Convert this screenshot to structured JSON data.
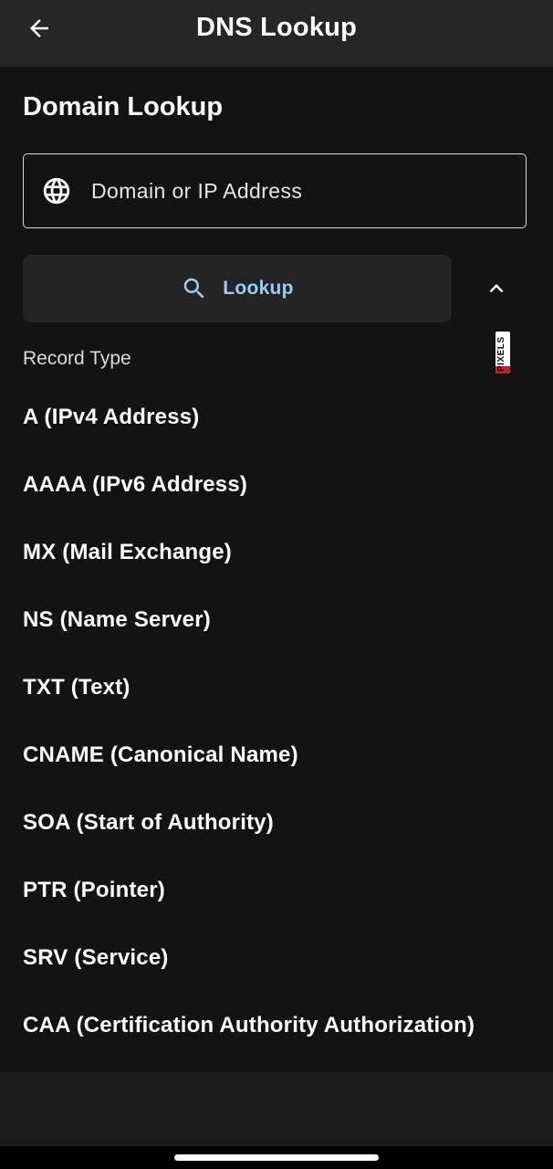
{
  "appbar": {
    "title": "DNS Lookup",
    "back_icon": "arrow-left-icon"
  },
  "form": {
    "section_title": "Domain Lookup",
    "input": {
      "placeholder": "Domain or IP Address",
      "value": "",
      "icon": "globe-icon"
    },
    "lookup_button": {
      "label": "Lookup",
      "icon": "search-icon",
      "color": "#99cdf6"
    },
    "expand_icon": "chevron-up-icon"
  },
  "dropdown": {
    "label": "Record Type",
    "badge_text": "PIXELS",
    "options": [
      "A (IPv4 Address)",
      "AAAA (IPv6 Address)",
      "MX (Mail Exchange)",
      "NS (Name Server)",
      "TXT (Text)",
      "CNAME (Canonical Name)",
      "SOA (Start of Authority)",
      "PTR (Pointer)",
      "SRV (Service)",
      "CAA (Certification Authority Authorization)"
    ]
  },
  "colors": {
    "background": "#131313",
    "appbar": "#262626",
    "button_bg": "#242424",
    "accent": "#99cdf6"
  }
}
